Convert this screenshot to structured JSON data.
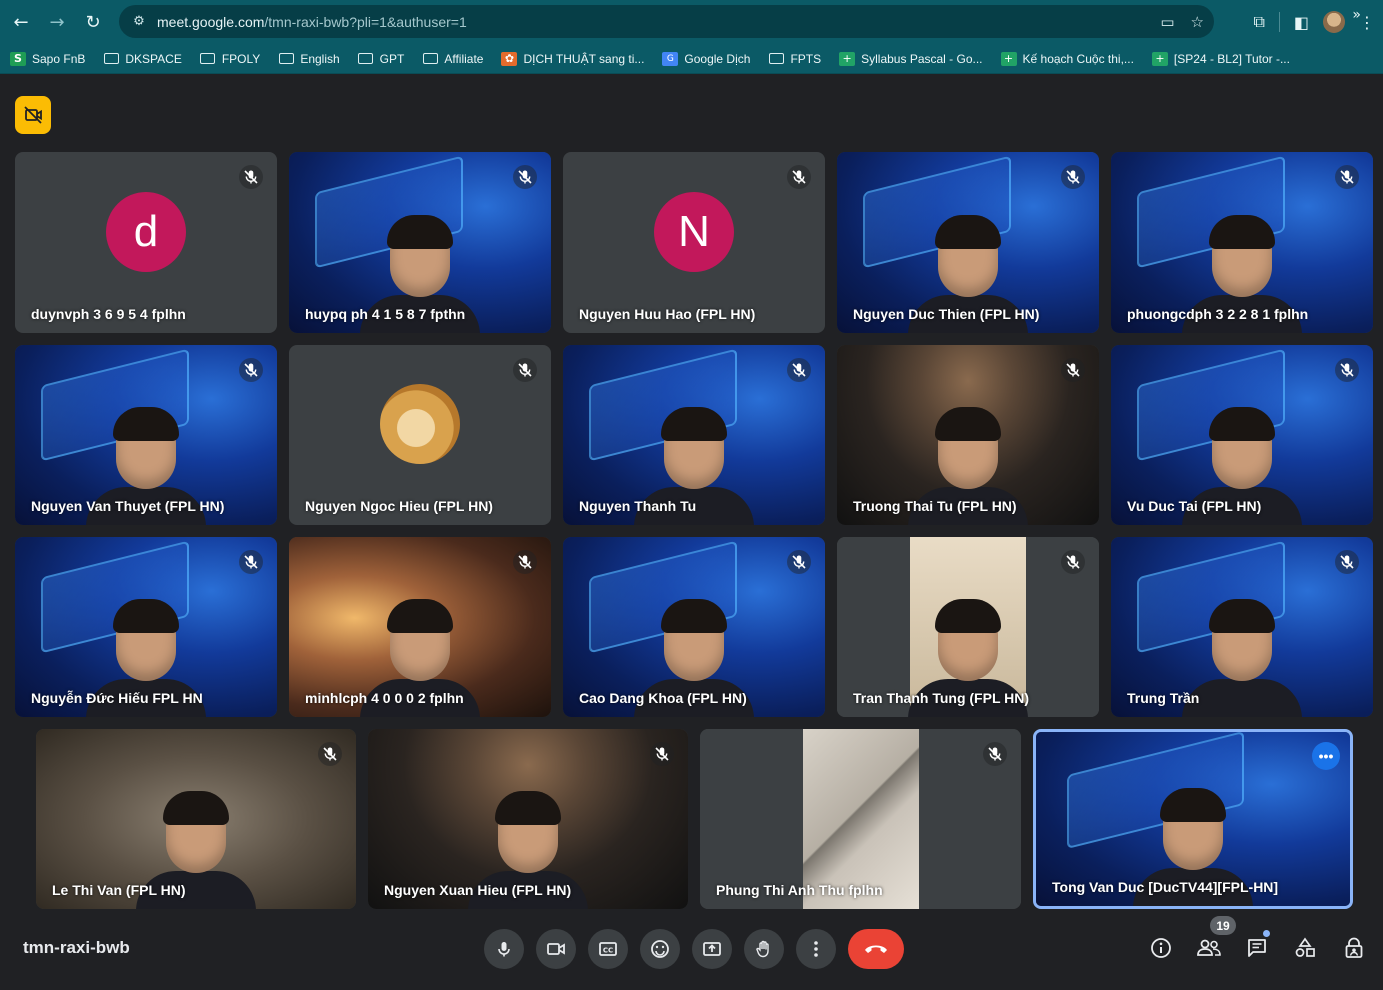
{
  "browser": {
    "url_host": "meet.google.com",
    "url_path": "/tmn-raxi-bwb?pli=1&authuser=1",
    "bookmarks": [
      {
        "label": "Sapo FnB",
        "icon": "sapo-icon"
      },
      {
        "label": "DKSPACE",
        "icon": "folder-icon"
      },
      {
        "label": "FPOLY",
        "icon": "folder-icon"
      },
      {
        "label": "English",
        "icon": "folder-icon"
      },
      {
        "label": "GPT",
        "icon": "folder-icon"
      },
      {
        "label": "Affiliate",
        "icon": "folder-icon"
      },
      {
        "label": "DỊCH THUẬT sang ti...",
        "icon": "translate-icon"
      },
      {
        "label": "Google Dịch",
        "icon": "google-translate-icon"
      },
      {
        "label": "FPTS",
        "icon": "folder-icon"
      },
      {
        "label": "Syllabus Pascal - Go...",
        "icon": "sheets-icon"
      },
      {
        "label": "Kế hoạch Cuộc thi,...",
        "icon": "sheets-icon"
      },
      {
        "label": "[SP24 - BL2] Tutor -...",
        "icon": "sheets-icon"
      }
    ]
  },
  "meeting": {
    "code": "tmn-raxi-bwb",
    "participant_count": "19"
  },
  "participants": [
    {
      "name": "duynvph 3 6 9 5 4 fplhn",
      "avatar_letter": "d",
      "avatar_color": "#c2185b",
      "bg": "avatar"
    },
    {
      "name": "huypq ph 4 1 5 8 7 fpthn",
      "bg": "blue"
    },
    {
      "name": "Nguyen Huu Hao (FPL HN)",
      "avatar_letter": "N",
      "avatar_color": "#c2185b",
      "bg": "avatar"
    },
    {
      "name": "Nguyen Duc Thien (FPL HN)",
      "bg": "blue"
    },
    {
      "name": "phuongcdph 3 2 2 8 1 fplhn",
      "bg": "blue"
    },
    {
      "name": "Nguyen Van Thuyet (FPL HN)",
      "bg": "blue"
    },
    {
      "name": "Nguyen Ngoc Hieu (FPL HN)",
      "bg": "doge"
    },
    {
      "name": "Nguyen Thanh Tu",
      "bg": "blue"
    },
    {
      "name": "Truong Thai Tu (FPL HN)",
      "bg": "space"
    },
    {
      "name": "Vu Duc Tai (FPL HN)",
      "bg": "blue"
    },
    {
      "name": "Nguyễn Đức Hiếu FPL HN",
      "bg": "blue"
    },
    {
      "name": "minhlcph 4 0 0 0 2 fplhn",
      "bg": "room"
    },
    {
      "name": "Cao Dang Khoa (FPL HN)",
      "bg": "blue"
    },
    {
      "name": "Tran Thanh Tung (FPL HN)",
      "bg": "cream"
    },
    {
      "name": "Trung Trần",
      "bg": "blue"
    },
    {
      "name": "Le Thi Van (FPL HN)",
      "bg": "wall"
    },
    {
      "name": "Nguyen Xuan Hieu (FPL HN)",
      "bg": "space"
    },
    {
      "name": "Phung Thi Anh Thu fplhn",
      "bg": "grey"
    },
    {
      "name": "Tong Van Duc [DucTV44][FPL-HN]",
      "bg": "blue",
      "active": true
    }
  ]
}
